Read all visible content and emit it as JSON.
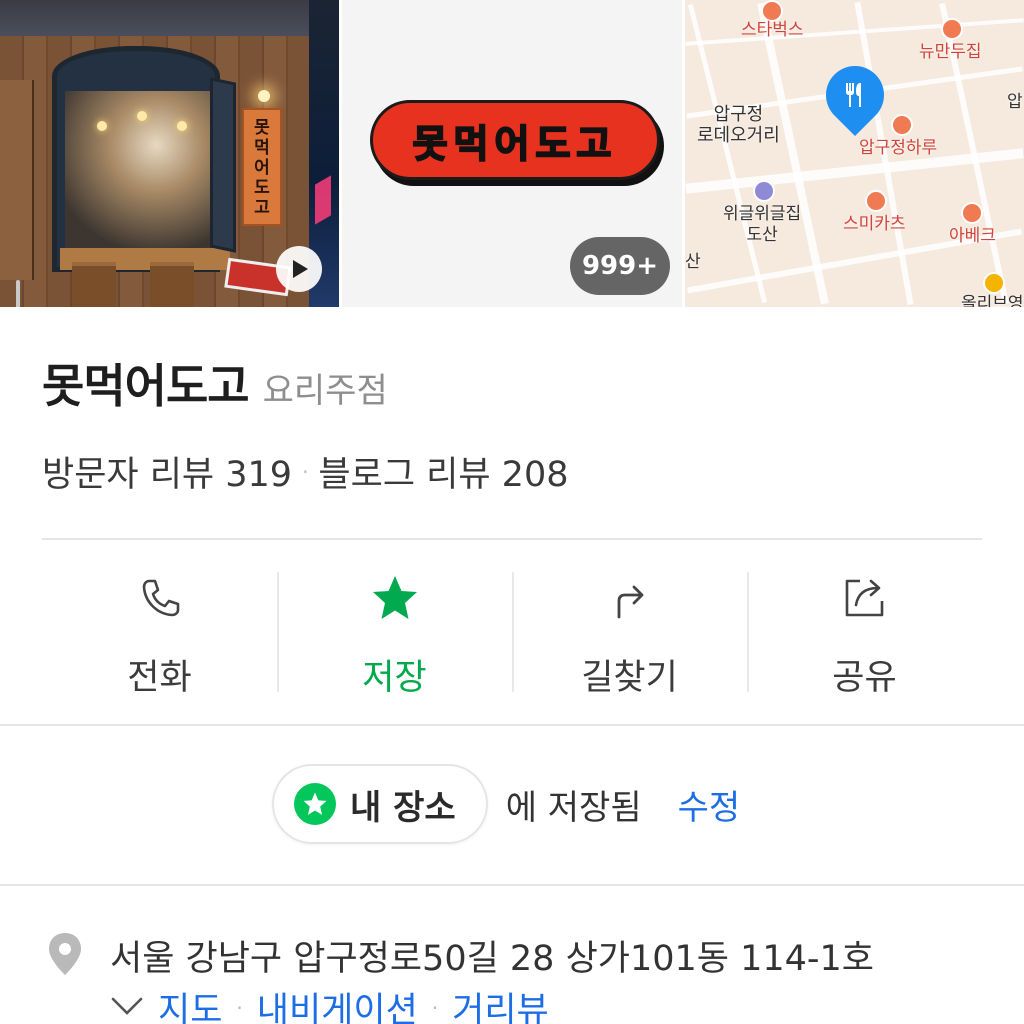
{
  "photos": {
    "storefront_sign": "못먹어도고",
    "logo_text": "못먹어도고",
    "photo_count": "999+"
  },
  "map": {
    "labels": {
      "starbucks": "스타벅스",
      "newmandu": "뉴만두집",
      "apgu_partial": "압",
      "rodeo": "압구정\n로데오거리",
      "apgujeonghaaru": "압구정하루",
      "wiggle": "위글위글집\n도산",
      "sumikatsu": "스미카츠",
      "abeke": "아베크",
      "san": "산",
      "bottom_partial": "올리브영"
    }
  },
  "place": {
    "name": "못먹어도고",
    "category": "요리주점",
    "visitor_reviews": "방문자 리뷰 319",
    "blog_reviews": "블로그 리뷰 208",
    "separator": "·"
  },
  "actions": [
    {
      "label": "전화",
      "icon": "phone-icon"
    },
    {
      "label": "저장",
      "icon": "star-icon",
      "active": true
    },
    {
      "label": "길찾기",
      "icon": "directions-icon"
    },
    {
      "label": "공유",
      "icon": "share-icon"
    }
  ],
  "saved": {
    "chip_label": "내 장소",
    "suffix": "에 저장됨",
    "edit": "수정"
  },
  "address": {
    "text": "서울 강남구 압구정로50길 28 상가101동 114-1호",
    "links": [
      "지도",
      "내비게이션",
      "거리뷰"
    ]
  },
  "colors": {
    "accent_green": "#03c75a",
    "link_blue": "#1d6ee6",
    "logo_red": "#e6321e",
    "map_pin_blue": "#1f8ef1"
  }
}
